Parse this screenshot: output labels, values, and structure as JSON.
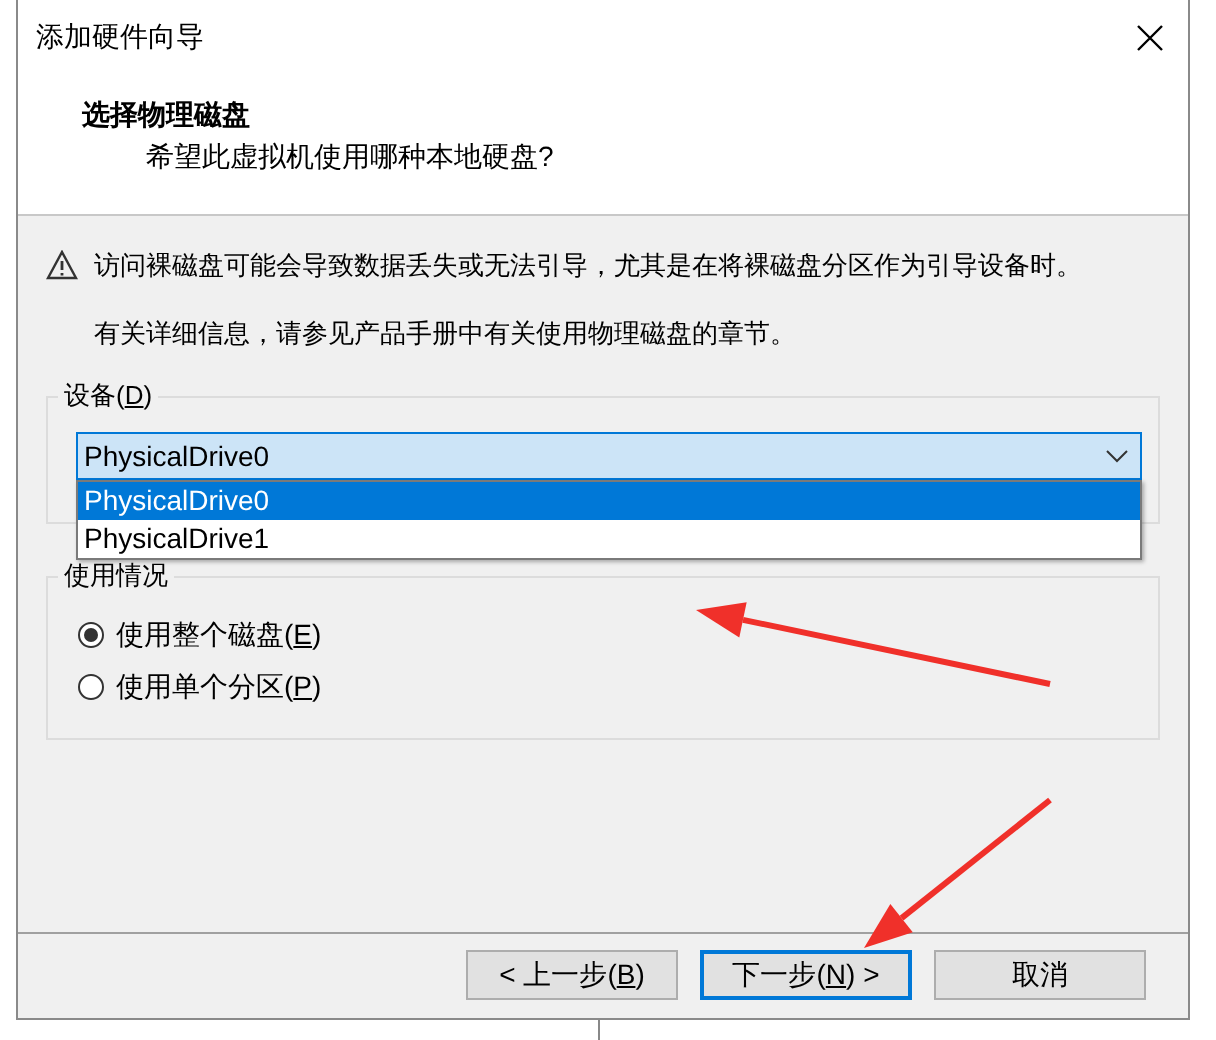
{
  "window": {
    "title": "添加硬件向导"
  },
  "header": {
    "title": "选择物理磁盘",
    "subtitle": "希望此虚拟机使用哪种本地硬盘?"
  },
  "warning": "访问裸磁盘可能会导致数据丢失或无法引导，尤其是在将裸磁盘分区作为引导设备时。",
  "info": "有关详细信息，请参见产品手册中有关使用物理磁盘的章节。",
  "device": {
    "label": [
      "设备(",
      "D",
      ")"
    ],
    "value": "PhysicalDrive0",
    "expanded": true,
    "options": [
      {
        "label": "PhysicalDrive0",
        "selected": true
      },
      {
        "label": "PhysicalDrive1",
        "selected": false
      }
    ]
  },
  "usage": {
    "label": "使用情况",
    "options": [
      {
        "label": [
          "使用整个磁盘(",
          "E",
          ")"
        ],
        "selected": true
      },
      {
        "label": [
          "使用单个分区(",
          "P",
          ")"
        ],
        "selected": false
      }
    ]
  },
  "buttons": [
    {
      "label": [
        "< 上一步(",
        "B",
        ")"
      ],
      "default": false
    },
    {
      "label": [
        "下一步(",
        "N",
        ") >"
      ],
      "default": true
    },
    {
      "label": [
        "取消"
      ],
      "default": false
    }
  ]
}
